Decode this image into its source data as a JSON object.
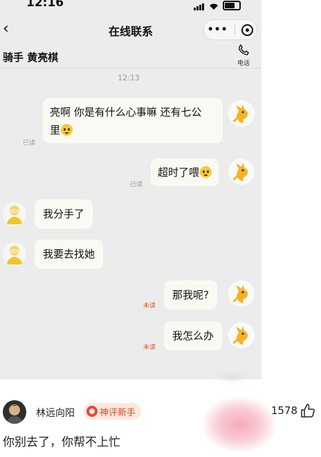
{
  "status_bar": {
    "time": "12:16"
  },
  "nav": {
    "title": "在线联系"
  },
  "rider": {
    "name": "骑手 黄亮棋",
    "call_label": "电话"
  },
  "chat": {
    "timestamp": "12:13",
    "messages": [
      {
        "from": "me",
        "lines": [
          "亮啊 你是有什么心事嘛 还有七公",
          "里"
        ],
        "emoji": "pleading-face",
        "status": "已读"
      },
      {
        "from": "me",
        "lines": [
          "超时了喂"
        ],
        "emoji": "pleading-face",
        "status": "已读"
      },
      {
        "from": "rider",
        "lines": [
          "我分手了"
        ]
      },
      {
        "from": "rider",
        "lines": [
          "我要去找她"
        ]
      },
      {
        "from": "me",
        "lines": [
          "那我呢?"
        ],
        "status": "未读"
      },
      {
        "from": "me",
        "lines": [
          "我怎么办"
        ],
        "status": "未读"
      }
    ]
  },
  "comment": {
    "username": "林远向阳",
    "badge": "神评新手",
    "likes": "1578",
    "text": "你别去了，你帮不上忙"
  },
  "colors": {
    "chat_bg": "#ececec",
    "unread": "#e0531e",
    "read": "#9a9a9a",
    "badge_bg": "#fbe9dc"
  },
  "icons": [
    "back-arrow-icon",
    "more-dots-icon",
    "target-icon",
    "phone-icon",
    "kangaroo-avatar",
    "rider-avatar",
    "thumbs-up-icon"
  ]
}
